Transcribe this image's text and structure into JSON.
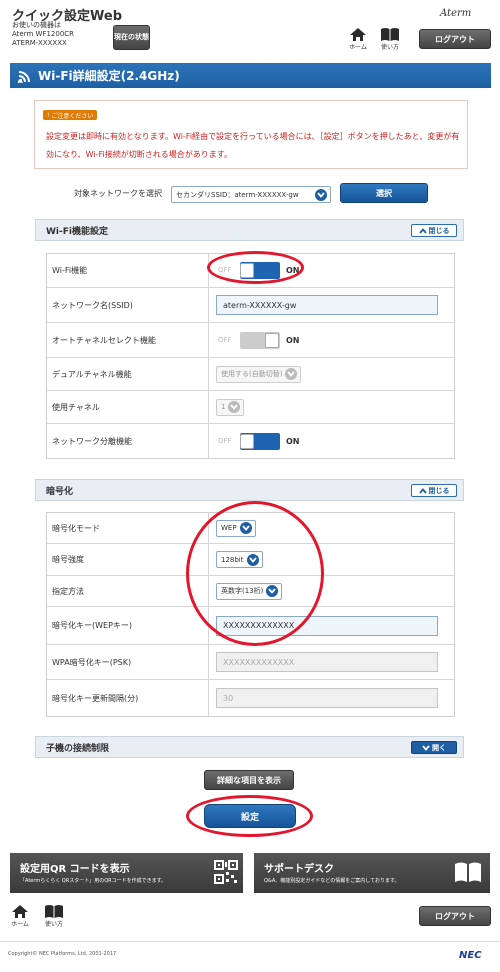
{
  "header": {
    "title": "クイック設定Web",
    "device_line1": "お使いの機器は",
    "device_line2": "Aterm WF1200CR",
    "device_line3": "ATERM-XXXXXX",
    "status_button": "現在の状態",
    "brand": "Aterm",
    "home_label": "ホーム",
    "help_label": "使い方",
    "logout_label": "ログアウト"
  },
  "page": {
    "title": "Wi-Fi詳細設定(2.4GHz)"
  },
  "notice": {
    "badge": "ご注意ください",
    "text": "設定変更は即時に有効となります。Wi-Fi経由で設定を行っている場合には、［設定］ボタンを押したあと、変更が有効になり、Wi-Fi接続が切断される場合があります。"
  },
  "target_network": {
    "label": "対象ネットワークを選択",
    "selected": "セカンダリSSID：aterm-XXXXXX-gw",
    "select_button": "選択"
  },
  "wifi_section": {
    "title": "Wi-Fi機能設定",
    "close_label": "閉じる",
    "rows": {
      "wifi_function": {
        "label": "Wi-Fi機能",
        "off": "OFF",
        "on": "ON"
      },
      "ssid": {
        "label": "ネットワーク名(SSID)",
        "value": "aterm-XXXXXX-gw"
      },
      "auto_channel": {
        "label": "オートチャネルセレクト機能",
        "off": "OFF",
        "on": "ON"
      },
      "dual_channel": {
        "label": "デュアルチャネル機能",
        "value": "使用する(自動切替)"
      },
      "channel": {
        "label": "使用チャネル",
        "value": "1"
      },
      "separation": {
        "label": "ネットワーク分離機能",
        "off": "OFF",
        "on": "ON"
      }
    }
  },
  "encryption_section": {
    "title": "暗号化",
    "close_label": "閉じる",
    "rows": {
      "mode": {
        "label": "暗号化モード",
        "value": "WEP"
      },
      "strength": {
        "label": "暗号強度",
        "value": "128bit"
      },
      "method": {
        "label": "指定方法",
        "value": "英数字(13桁)"
      },
      "wep_key": {
        "label": "暗号化キー(WEPキー)",
        "value": "XXXXXXXXXXXXX"
      },
      "psk": {
        "label": "WPA暗号化キー(PSK)",
        "value": "XXXXXXXXXXXXX"
      },
      "interval": {
        "label": "暗号化キー更新間隔(分)",
        "value": "30"
      }
    }
  },
  "client_section": {
    "title": "子機の接続制限",
    "open_label": "開く"
  },
  "actions": {
    "show_details": "詳細な項目を表示",
    "apply": "設定"
  },
  "cards": {
    "qr_title": "設定用QR コードを表示",
    "qr_sub": "「Atermらくらく QRスタート」用のQRコードを作成できます。",
    "support_title": "サポートデスク",
    "support_sub": "Q&A、機能別設定ガイドなどの情報をご案内しております。"
  },
  "footer": {
    "home_label": "ホーム",
    "help_label": "使い方",
    "logout_label": "ログアウト",
    "copyright": "Copyright© NEC Platforms, Ltd. 2001-2017",
    "nec": "NEC"
  },
  "colors": {
    "primary_blue": "#1e5fa3",
    "notice_red": "#d02020",
    "highlight_red": "#e3162b",
    "dark_button": "#444444"
  }
}
